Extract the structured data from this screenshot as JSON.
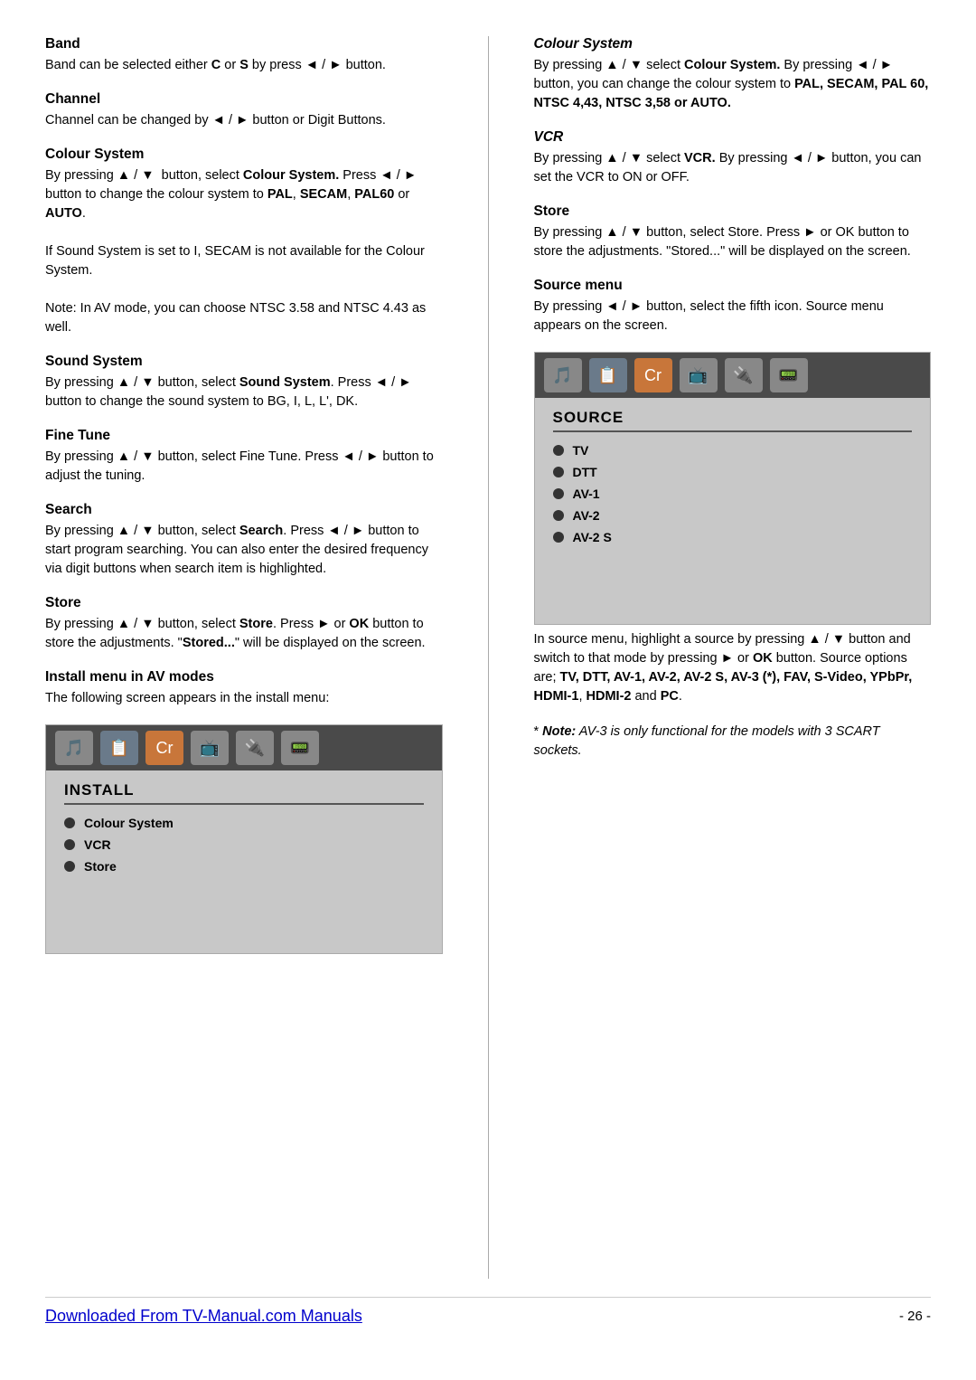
{
  "left_column": {
    "sections": [
      {
        "id": "band",
        "title": "Band",
        "title_style": "bold",
        "body": "Band can be selected either <b>C</b> or <b>S</b> by press ◄ / ► button."
      },
      {
        "id": "channel",
        "title": "Channel",
        "title_style": "bold",
        "body": "Channel can be changed by  ◄ / ► button or Digit Buttons."
      },
      {
        "id": "colour-system",
        "title": "Colour System",
        "title_style": "bold",
        "body": "By pressing ▲ / ▼  button, select <b>Colour System.</b> Press ◄ / ► button to change the colour system to <b>PAL</b>, <b>SECAM</b>, <b>PAL60</b> or <b>AUTO</b>.\n\nIf Sound System is set to I, SECAM is not available for the Colour System.\n\nNote: In AV mode, you can choose NTSC 3.58 and NTSC 4.43 as well."
      },
      {
        "id": "sound-system",
        "title": "Sound System",
        "title_style": "bold",
        "body": "By pressing ▲ / ▼ button, select <b>Sound System</b>. Press ◄ / ► button to change the sound system to BG, I, L, L', DK."
      },
      {
        "id": "fine-tune",
        "title": "Fine Tune",
        "title_style": "bold",
        "body": "By pressing ▲ / ▼ button, select Fine Tune. Press ◄ / ► button to adjust the tuning."
      },
      {
        "id": "search",
        "title": "Search",
        "title_style": "bold",
        "body": "By pressing ▲ / ▼ button, select <b>Search</b>. Press ◄ / ► button to start program searching. You can also enter the desired frequency via digit buttons when search item is highlighted."
      },
      {
        "id": "store-left",
        "title": "Store",
        "title_style": "bold",
        "body": "By pressing ▲ / ▼ button, select <b>Store</b>. Press ► or <b>OK</b> button to store the adjustments. \"<b>Stored...</b>\" will be displayed on the screen."
      },
      {
        "id": "install-menu",
        "title": "Install menu in AV modes",
        "title_style": "bold",
        "body": "The following screen appears in the install menu:"
      }
    ],
    "install_menu": {
      "header": "INSTALL",
      "items": [
        "Colour System",
        "VCR",
        "Store"
      ]
    }
  },
  "right_column": {
    "sections": [
      {
        "id": "colour-system-right",
        "title": "Colour System",
        "title_style": "italic-bold",
        "body": "By pressing ▲ / ▼ select <b>Colour System.</b> By pressing ◄ / ► button, you can change the colour system to <b>PAL, SECAM, PAL 60, NTSC 4,43, NTSC 3,58 or AUTO.</b>"
      },
      {
        "id": "vcr",
        "title": "VCR",
        "title_style": "italic-bold",
        "body": "By pressing ▲ / ▼ select <b>VCR.</b> By pressing ◄ / ► button, you can set the VCR to ON or OFF."
      },
      {
        "id": "store-right",
        "title": "Store",
        "title_style": "bold",
        "body": "By pressing ▲ / ▼ button, select Store. Press ► or OK button to store the adjustments. \"Stored...\" will be displayed on the screen."
      },
      {
        "id": "source-menu",
        "title": "Source menu",
        "title_style": "bold",
        "body": "By pressing ◄ / ► button, select the fifth icon. Source menu appears on the screen."
      }
    ],
    "source_menu": {
      "header": "SOURCE",
      "items": [
        "TV",
        "DTT",
        "AV-1",
        "AV-2",
        "AV-2 S"
      ]
    },
    "after_source_body": "In source menu, highlight a source by pressing ▲ / ▼ button and switch to that mode by pressing ► or <b>OK</b> button. Source options are; <b>TV, DTT, AV-1, AV-2, AV-2 S, AV-3 (*), FAV, S-Video, YPbPr, HDMI-1</b>, <b>HDMI-2</b> and <b>PC</b>.",
    "note": "* <i><b>Note:</b> AV-3 is only functional for the models with 3 SCART sockets.</i>"
  },
  "footer": {
    "link_text": "Downloaded From TV-Manual.com Manuals",
    "page_number": "- 26 -"
  },
  "or_text": "or"
}
